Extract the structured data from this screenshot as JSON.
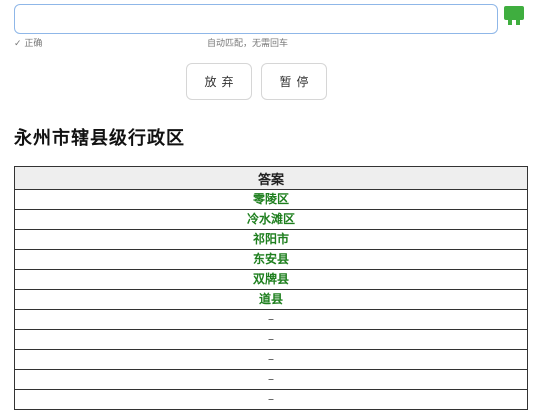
{
  "quiz": {
    "input_value": "",
    "status_text": "正确",
    "hint_text": "自动匹配，无需回车",
    "abandon_label": "放弃",
    "pause_label": "暂停",
    "title": "永州市辖县级行政区",
    "table_header": "答案",
    "answers": [
      "零陵区",
      "冷水滩区",
      "祁阳市",
      "东安县",
      "双牌县",
      "道县",
      "–",
      "–",
      "–",
      "–",
      "–"
    ]
  },
  "colors": {
    "correct_answer": "#1e7f1e",
    "input_border": "#8fb7e8",
    "corner_icon": "#3fae3f"
  }
}
